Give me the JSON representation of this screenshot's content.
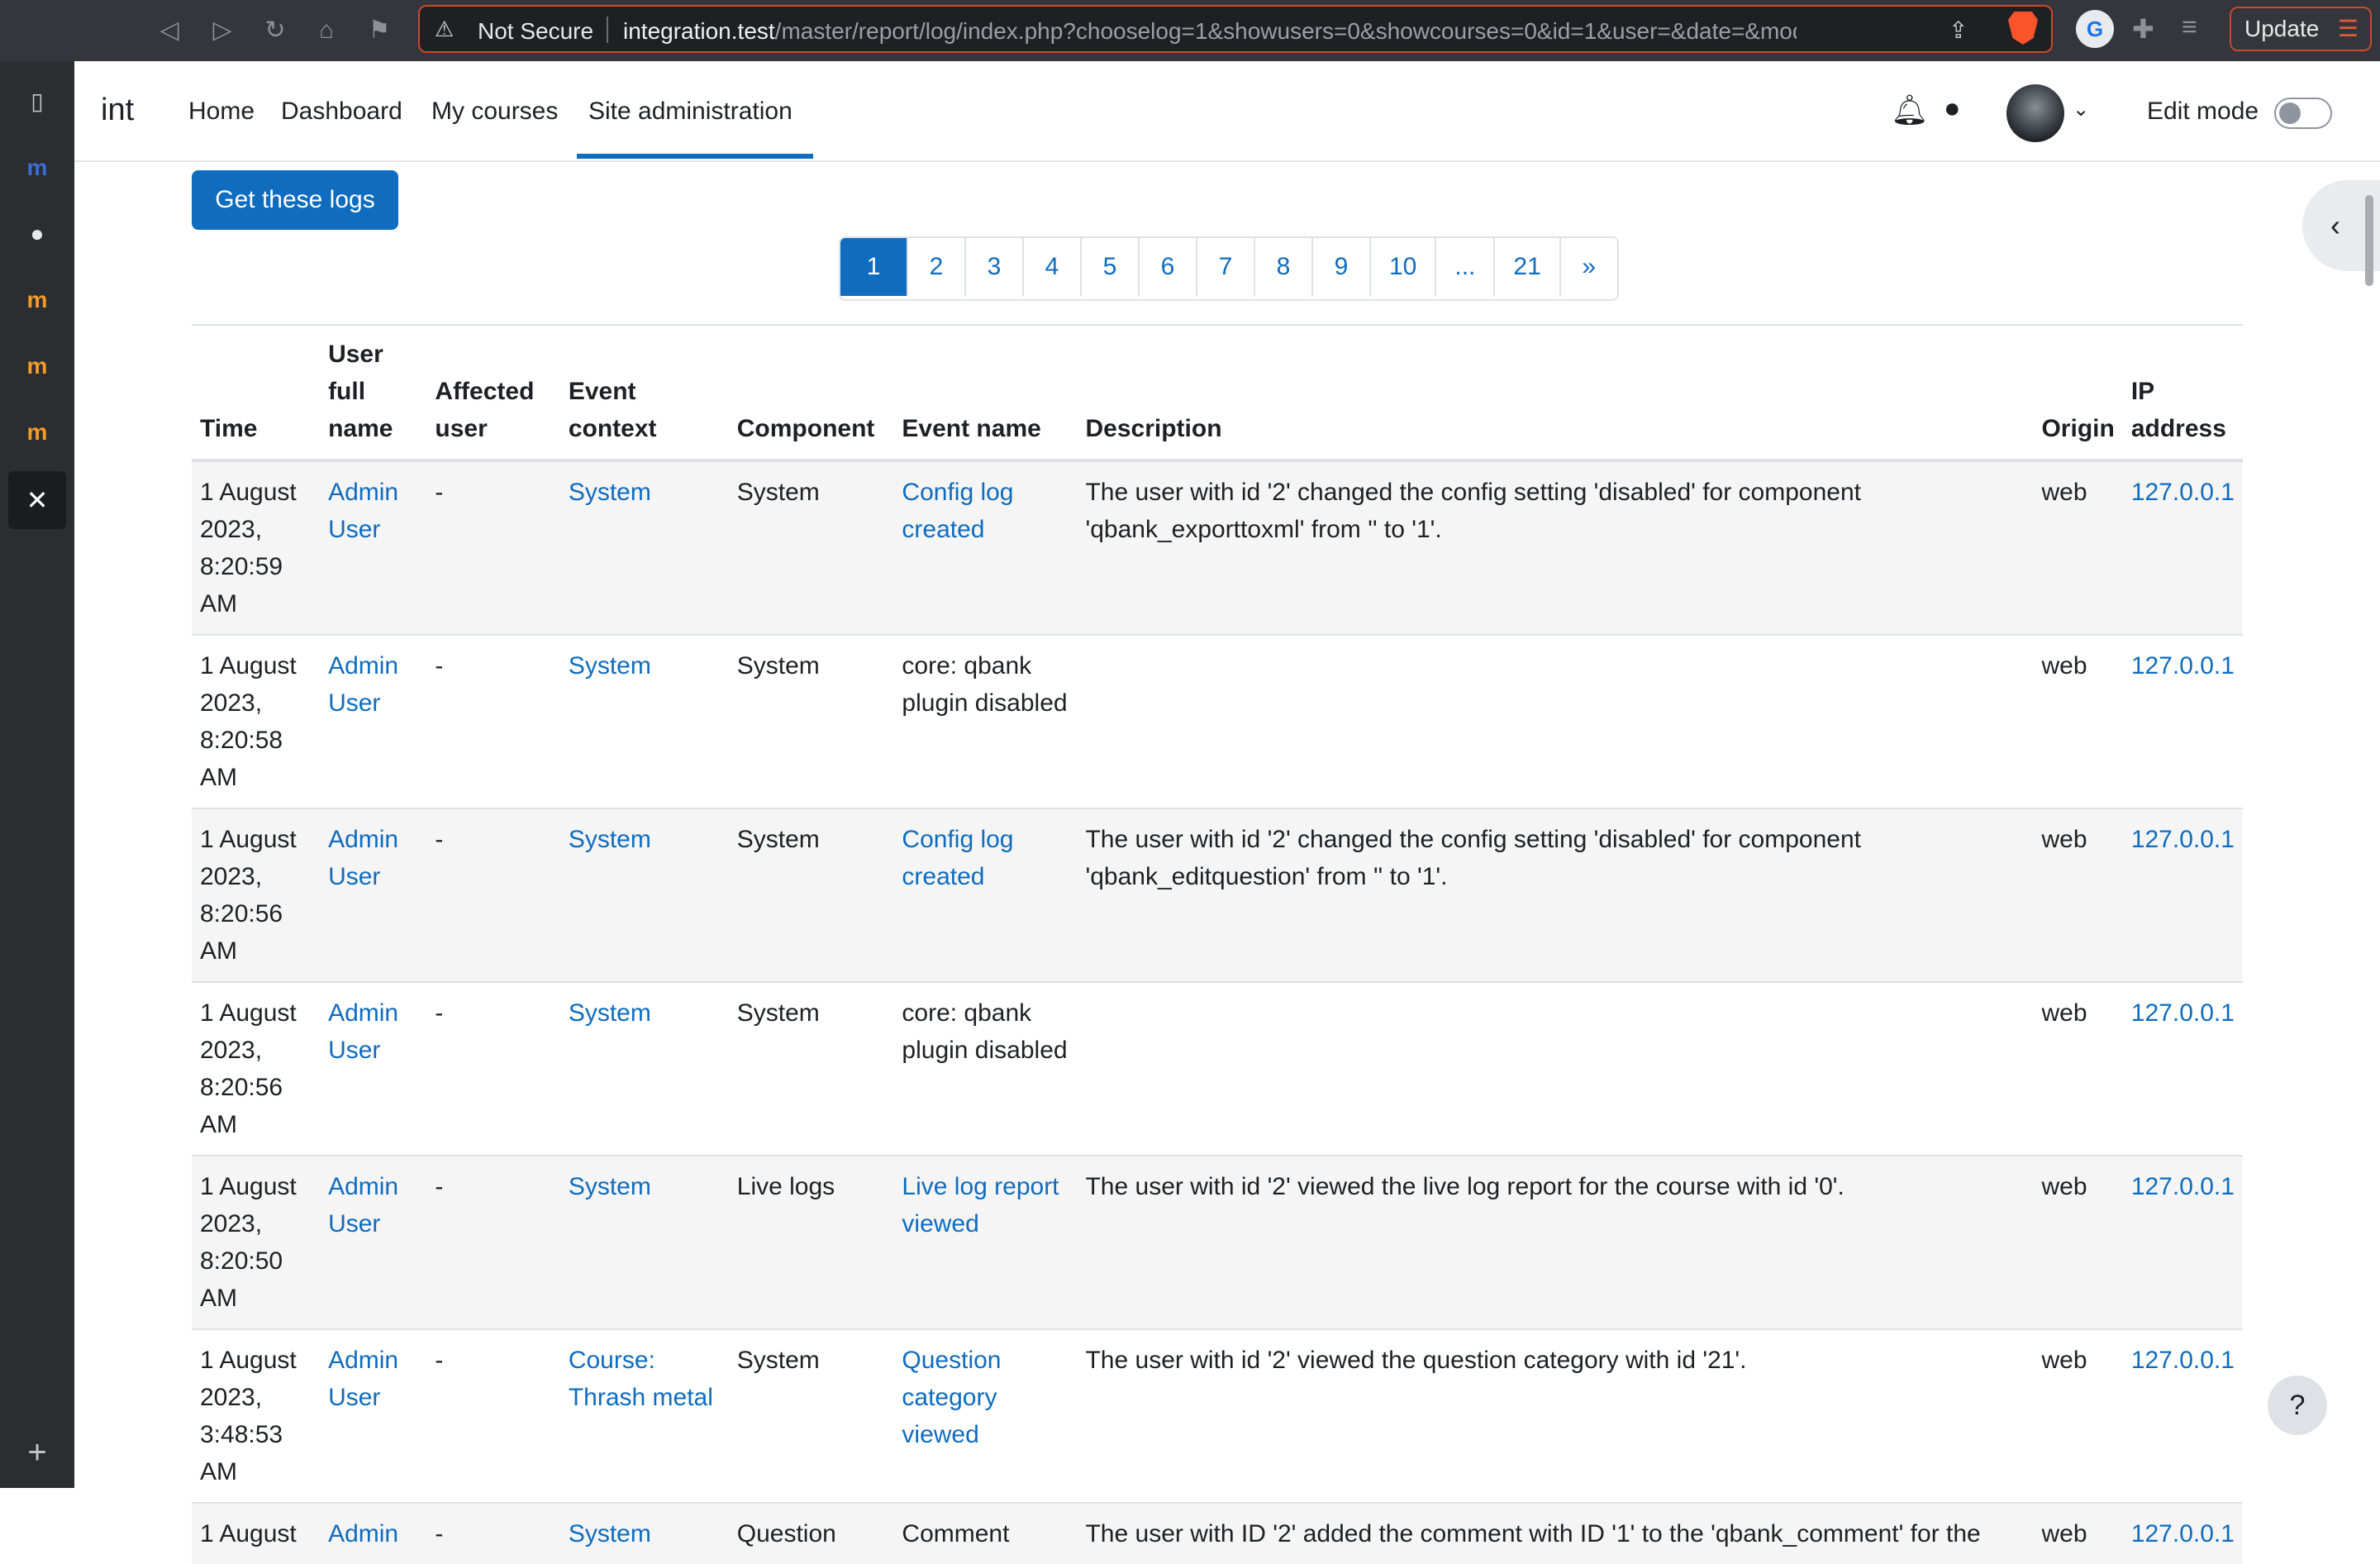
{
  "browser": {
    "security_label": "Not Secure",
    "url_host": "integration.test",
    "url_path": "/master/report/log/index.php?chooselog=1&showusers=0&showcourses=0&id=1&user=&date=&modid...",
    "update_label": "Update"
  },
  "navbar": {
    "brand": "int",
    "items": [
      "Home",
      "Dashboard",
      "My courses",
      "Site administration"
    ],
    "active_item": "Site administration",
    "edit_mode_label": "Edit mode",
    "edit_mode_on": false
  },
  "actions": {
    "get_logs_label": "Get these logs"
  },
  "pagination": {
    "pages": [
      "1",
      "2",
      "3",
      "4",
      "5",
      "6",
      "7",
      "8",
      "9",
      "10",
      "...",
      "21",
      "»"
    ],
    "current": "1"
  },
  "table": {
    "headers": {
      "time": "Time",
      "user_full_name": "User full name",
      "affected_user": "Affected user",
      "event_context": "Event context",
      "component": "Component",
      "event_name": "Event name",
      "description": "Description",
      "origin": "Origin",
      "ip_address": "IP address"
    },
    "rows": [
      {
        "time": "1 August 2023, 8:20:59 AM",
        "user": "Admin User",
        "affected": "-",
        "context": "System",
        "component": "System",
        "event": "Config log created",
        "description": "The user with id '2' changed the config setting 'disabled' for component 'qbank_exporttoxml' from '' to '1'.",
        "origin": "web",
        "ip": "127.0.0.1"
      },
      {
        "time": "1 August 2023, 8:20:58 AM",
        "user": "Admin User",
        "affected": "-",
        "context": "System",
        "component": "System",
        "event": "core: qbank plugin disabled",
        "description": "",
        "origin": "web",
        "ip": "127.0.0.1"
      },
      {
        "time": "1 August 2023, 8:20:56 AM",
        "user": "Admin User",
        "affected": "-",
        "context": "System",
        "component": "System",
        "event": "Config log created",
        "description": "The user with id '2' changed the config setting 'disabled' for component 'qbank_editquestion' from '' to '1'.",
        "origin": "web",
        "ip": "127.0.0.1"
      },
      {
        "time": "1 August 2023, 8:20:56 AM",
        "user": "Admin User",
        "affected": "-",
        "context": "System",
        "component": "System",
        "event": "core: qbank plugin disabled",
        "description": "",
        "origin": "web",
        "ip": "127.0.0.1"
      },
      {
        "time": "1 August 2023, 8:20:50 AM",
        "user": "Admin User",
        "affected": "-",
        "context": "System",
        "component": "Live logs",
        "event": "Live log report viewed",
        "description": "The user with id '2' viewed the live log report for the course with id '0'.",
        "origin": "web",
        "ip": "127.0.0.1"
      },
      {
        "time": "1 August 2023, 3:48:53 AM",
        "user": "Admin User",
        "affected": "-",
        "context": "Course: Thrash metal",
        "component": "System",
        "event": "Question category viewed",
        "description": "The user with id '2' viewed the question category with id '21'.",
        "origin": "web",
        "ip": "127.0.0.1"
      },
      {
        "time": "1 August",
        "user": "Admin",
        "affected": "-",
        "context": "System",
        "component": "Question",
        "event": "Comment",
        "description": "The user with ID '2' added the comment with ID '1' to the 'qbank_comment' for the",
        "origin": "web",
        "ip": "127.0.0.1"
      }
    ]
  },
  "help_label": "?"
}
